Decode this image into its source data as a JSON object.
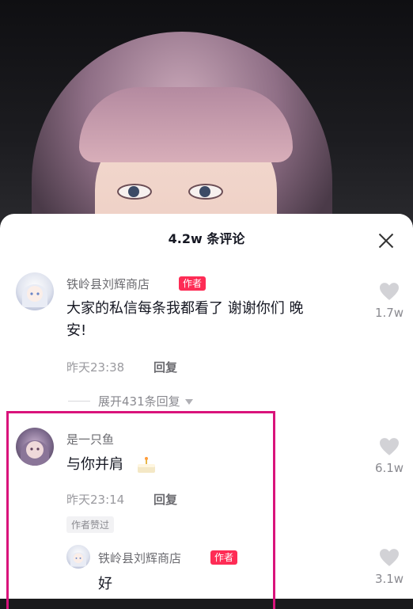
{
  "header": {
    "title": "4.2w 条评论"
  },
  "comments": [
    {
      "username": "铁岭县刘辉商店",
      "author_badge": "作者",
      "text_line1": "大家的私信每条我都看了 谢谢你们 晚",
      "text_line2": "安!",
      "time": "昨天23:38",
      "reply_label": "回复",
      "likes": "1.7w",
      "expand_label": "展开431条回复"
    },
    {
      "username": "是一只鱼",
      "text": "与你并肩",
      "time": "昨天23:14",
      "reply_label": "回复",
      "likes": "6.1w",
      "author_liked_label": "作者赞过",
      "reply": {
        "username": "铁岭县刘辉商店",
        "author_badge": "作者",
        "text": "好",
        "likes": "3.1w"
      }
    }
  ],
  "colors": {
    "accent": "#fe2c55",
    "highlight_border": "#d9137b"
  }
}
